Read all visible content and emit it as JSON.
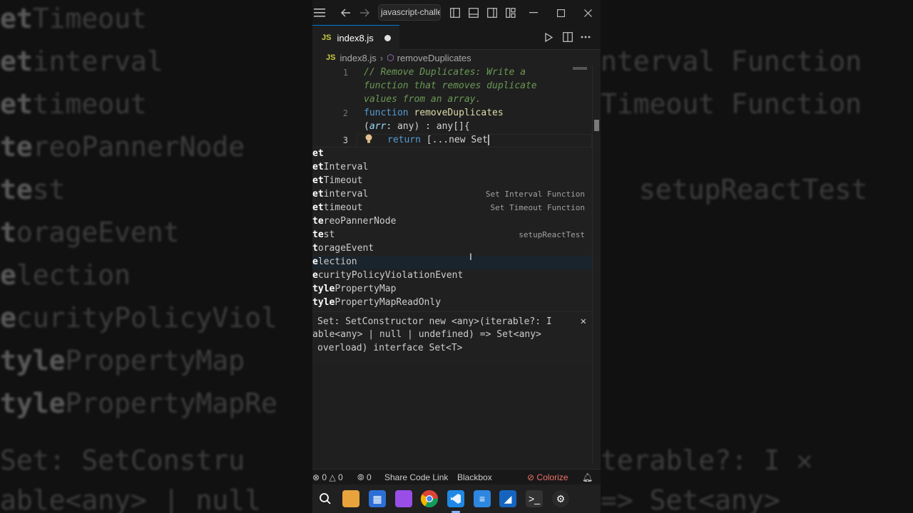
{
  "backdrop": {
    "left_lines": [
      {
        "bold": "et",
        "rest": "Timeout"
      },
      {
        "bold": "et",
        "rest": "interval"
      },
      {
        "bold": "et",
        "rest": "timeout"
      },
      {
        "bold": "te",
        "rest": "reoPannerNode"
      },
      {
        "bold": "te",
        "rest": "st"
      },
      {
        "bold": "t",
        "rest": "orageEvent"
      },
      {
        "bold": "e",
        "rest": "lection"
      },
      {
        "bold": "e",
        "rest": "curityPolicyViol"
      },
      {
        "bold": "tyle",
        "rest": "PropertyMap"
      },
      {
        "bold": "tyle",
        "rest": "PropertyMapRe"
      },
      {
        "bold": "",
        "rest": "  Set: SetConstru"
      },
      {
        "bold": "",
        "rest": "able<any> | null"
      }
    ],
    "right_lines": [
      "nterval Function",
      "Timeout Function",
      "setupReactTest",
      "terable?: I  ✕",
      "=> Set<any>"
    ]
  },
  "titlebar": {
    "search_text": "javascript-challe",
    "menu_icon": "hamburger-menu-icon",
    "back_icon": "arrow-left-icon",
    "forward_icon": "arrow-right-icon"
  },
  "tab": {
    "badge": "JS",
    "filename": "index8.js"
  },
  "breadcrumb": {
    "badge": "JS",
    "file": "index8.js",
    "symbol": "removeDuplicates"
  },
  "editor": {
    "line_numbers": [
      "1",
      "2",
      "3"
    ],
    "comment_1": "// Remove Duplicates: Write a",
    "comment_2": "function that removes duplicate",
    "comment_3": "values from an array.",
    "kw_function": "function",
    "fn_name": "removeDuplicates",
    "param_open": "(",
    "param_name": "arr",
    "param_rest": ": any) : any[]{",
    "kw_return": "return",
    "return_rest": " [...new Set"
  },
  "suggestions": [
    {
      "bold": "et",
      "rest": "",
      "detail": ""
    },
    {
      "bold": "et",
      "rest": "Interval",
      "detail": ""
    },
    {
      "bold": "et",
      "rest": "Timeout",
      "detail": ""
    },
    {
      "bold": "et",
      "rest": "interval",
      "detail": "Set Interval Function"
    },
    {
      "bold": "et",
      "rest": "timeout",
      "detail": "Set Timeout Function"
    },
    {
      "bold": "te",
      "rest": "reoPannerNode",
      "detail": ""
    },
    {
      "bold": "te",
      "rest": "st",
      "detail": "setupReactTest"
    },
    {
      "bold": "t",
      "rest": "orageEvent",
      "detail": ""
    },
    {
      "bold": "e",
      "rest": "lection",
      "detail": ""
    },
    {
      "bold": "e",
      "rest": "curityPolicyViolationEvent",
      "detail": ""
    },
    {
      "bold": "tyle",
      "rest": "PropertyMap",
      "detail": ""
    },
    {
      "bold": "tyle",
      "rest": "PropertyMapReadOnly",
      "detail": ""
    }
  ],
  "suggest_doc": {
    "line_1": "Set: SetConstructor new <any>(iterable?: I",
    "line_2": "able<any> | null | undefined) => Set<any>",
    "line_3": "overload) interface Set<T>"
  },
  "statusbar": {
    "errors": "0",
    "warnings": "0",
    "ports": "0",
    "share": "Share Code Link",
    "blackbox": "Blackbox",
    "colorize": "Colorize"
  },
  "taskbar": {
    "icons": [
      "search-icon",
      "file-explorer-icon",
      "store-icon",
      "clipchamp-icon",
      "chrome-icon",
      "vscode-icon",
      "notepad-icon",
      "paint-icon",
      "terminal-icon",
      "settings-icon"
    ]
  },
  "colors": {
    "accent": "#0078d4",
    "colorize": "#f07167",
    "comment": "#6a9955",
    "keyword": "#569cd6",
    "function": "#dcdcaa"
  }
}
